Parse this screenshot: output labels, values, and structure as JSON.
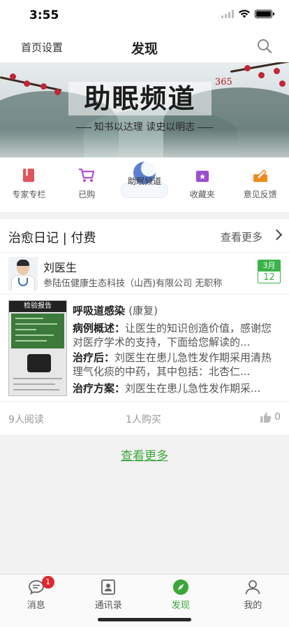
{
  "status": {
    "time": "3:55"
  },
  "nav": {
    "left_label": "首页设置",
    "title": "发现",
    "search_icon": "search-icon"
  },
  "banner": {
    "title": "助眠频道",
    "seal": "365",
    "subtitle": "知书以达理 读史以明志"
  },
  "shortcuts": [
    {
      "label": "专家专栏",
      "icon": "book-icon",
      "color": "#e0545c"
    },
    {
      "label": "已购",
      "icon": "cart-icon",
      "color": "#b64fd0"
    },
    {
      "label": "助眠频道",
      "icon": "moon-icon",
      "color": "#5b7fd0"
    },
    {
      "label": "收藏夹",
      "icon": "star-folder-icon",
      "color": "#9b4fd0"
    },
    {
      "label": "意见反馈",
      "icon": "feedback-icon",
      "color": "#f08a1c"
    }
  ],
  "section": {
    "title": "治愈日记 | 付费",
    "more_label": "查看更多"
  },
  "doctor": {
    "name": "刘医生",
    "info": "参陆伍健康生态科技（山西)有限公司 无职称",
    "date_month": "3月",
    "date_day": "12"
  },
  "article": {
    "image_label": "检验报告",
    "title": "呼吸道感染",
    "title_suffix": "(康复)",
    "p1_label": "病例概述：",
    "p1_text": "让医生的知识创造价值，感谢您对医疗学术的支持，下面给您解读的...",
    "p2_label": "治疗后：",
    "p2_text": "刘医生在患儿急性发作期采用清热理气化痰的中药，其中包括：北杏仁...",
    "p3_label": "治疗方案：",
    "p3_text": "刘医生在患儿急性发作期采..."
  },
  "stats": {
    "reads": "9人阅读",
    "buys": "1人购买",
    "likes": "0"
  },
  "more_button": "查看更多",
  "tabbar": [
    {
      "label": "消息",
      "icon": "chat-icon",
      "badge": "1"
    },
    {
      "label": "通讯录",
      "icon": "contacts-icon"
    },
    {
      "label": "发现",
      "icon": "compass-icon",
      "active": true
    },
    {
      "label": "我的",
      "icon": "person-icon"
    }
  ],
  "colors": {
    "accent": "#3aa63a",
    "badge": "#e0262d",
    "date_green": "#3bb34a"
  }
}
